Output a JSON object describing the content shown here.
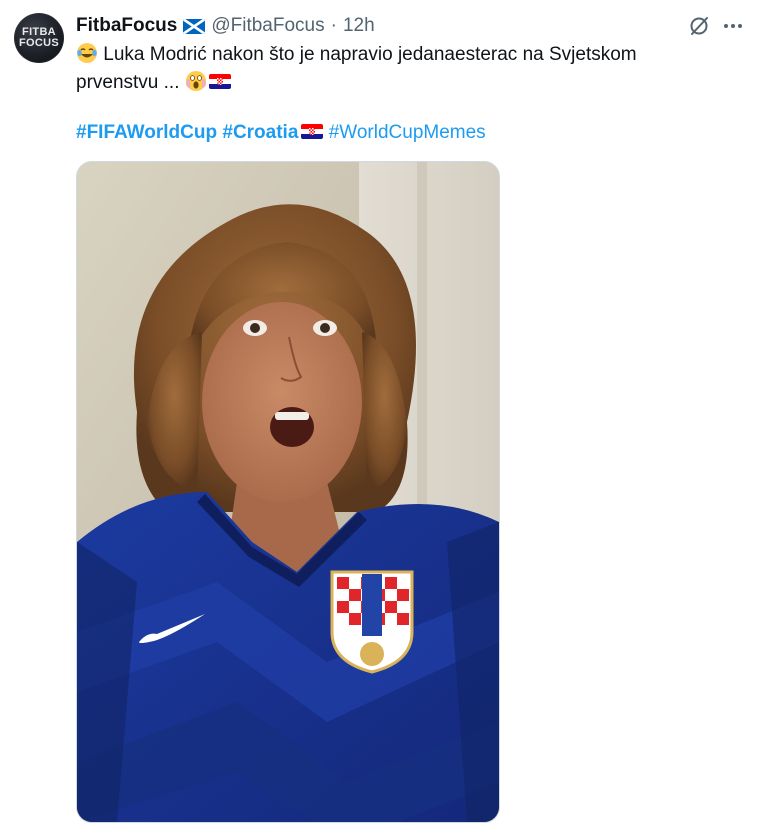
{
  "tweet": {
    "avatar_text_line1": "FITBA",
    "avatar_text_line2": "FOCUS",
    "display_name": "FitbaFocus",
    "handle": "@FitbaFocus",
    "separator": "·",
    "time": "12h",
    "text_line1": " Luka Modrić nakon što je napravio jedanaesterac na Svjetskom",
    "text_line2": "prvenstvu ... ",
    "hashtag_1": "#FIFAWorldCup",
    "hashtag_2": "#Croatia",
    "hashtag_3": "#WorldCupMemes",
    "media_description": "meme photo: shocked woman in Croatia jersey",
    "colors": {
      "link": "#1d9bf0",
      "secondary_text": "#536471",
      "jersey_blue": "#1a2f8e"
    },
    "icons": [
      "scotland-flag-icon",
      "grok-icon",
      "more-icon",
      "laughing-emoji-icon",
      "screaming-emoji-icon",
      "croatia-flag-icon"
    ]
  }
}
